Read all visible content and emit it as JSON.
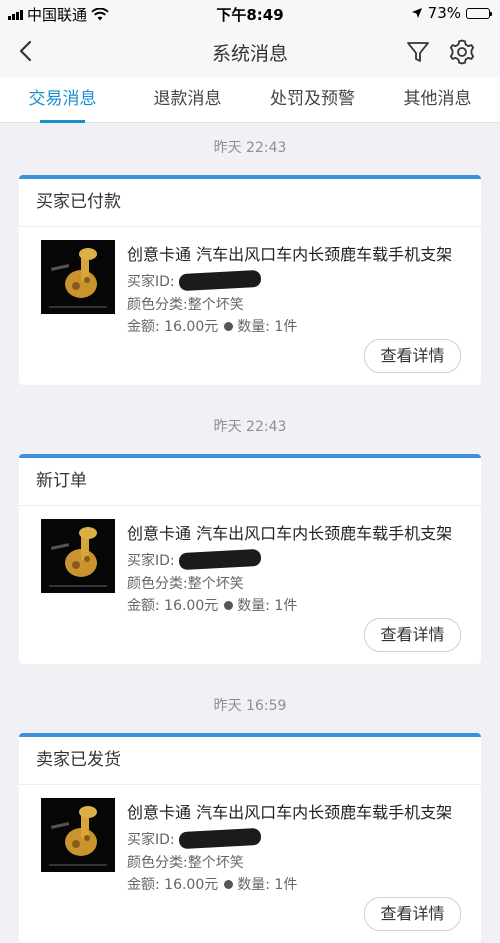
{
  "status_bar": {
    "carrier": "中国联通",
    "time": "下午8:49",
    "battery_text": "73%",
    "battery_level": 0.73
  },
  "nav": {
    "title": "系统消息",
    "back_icon": "chevron-left-icon",
    "filter_icon": "filter-icon",
    "settings_icon": "gear-icon"
  },
  "tabs": [
    {
      "label": "交易消息",
      "active": true
    },
    {
      "label": "退款消息",
      "active": false
    },
    {
      "label": "处罚及预警",
      "active": false
    },
    {
      "label": "其他消息",
      "active": false
    }
  ],
  "colors": {
    "accent": "#1a8fd0",
    "card_top_bar": "#3d8fd9"
  },
  "messages": [
    {
      "time": "昨天 22:43",
      "title": "买家已付款",
      "product": "创意卡通 汽车出风口车内长颈鹿车载手机支架",
      "buyer_label": "买家ID:",
      "color_label": "颜色分类:整个坏笑",
      "amount_label": "金额: 16.00元",
      "quantity_label": "数量: 1件",
      "button": "查看详情"
    },
    {
      "time": "昨天 22:43",
      "title": "新订单",
      "product": "创意卡通 汽车出风口车内长颈鹿车载手机支架",
      "buyer_label": "买家ID:",
      "color_label": "颜色分类:整个坏笑",
      "amount_label": "金额: 16.00元",
      "quantity_label": "数量: 1件",
      "button": "查看详情"
    },
    {
      "time": "昨天 16:59",
      "title": "卖家已发货",
      "product": "创意卡通 汽车出风口车内长颈鹿车载手机支架",
      "buyer_label": "买家ID:",
      "color_label": "颜色分类:整个坏笑",
      "amount_label": "金额: 16.00元",
      "quantity_label": "数量: 1件",
      "button": "查看详情"
    }
  ]
}
